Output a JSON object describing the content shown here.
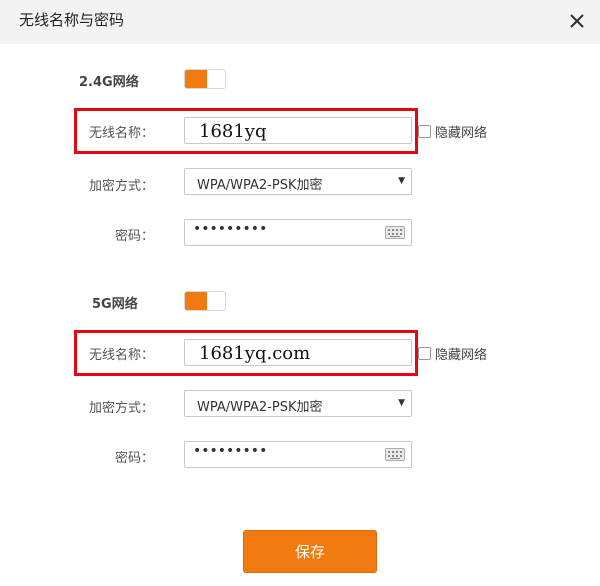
{
  "dialog": {
    "title": "无线名称与密码"
  },
  "band_24": {
    "label": "2.4G网络",
    "enabled": true,
    "ssid_label": "无线名称：",
    "ssid_value": "1681yq",
    "hide_label": "隐藏网络",
    "hide_checked": false,
    "encryption_label": "加密方式：",
    "encryption_value": "WPA/WPA2-PSK加密",
    "password_label": "密码：",
    "password_value": "•••••••••"
  },
  "band_5": {
    "label": "5G网络",
    "enabled": true,
    "ssid_label": "无线名称：",
    "ssid_value": "1681yq.com",
    "hide_label": "隐藏网络",
    "hide_checked": false,
    "encryption_label": "加密方式：",
    "encryption_value": "WPA/WPA2-PSK加密",
    "password_label": "密码：",
    "password_value": "•••••••••"
  },
  "actions": {
    "save_label": "保存"
  },
  "colors": {
    "accent": "#f17a10",
    "highlight": "#e30613",
    "header_bg": "#f3f3f3"
  },
  "icons": {
    "close": "close-icon",
    "keyboard": "keyboard-icon",
    "dropdown": "dropdown-arrow-icon"
  }
}
